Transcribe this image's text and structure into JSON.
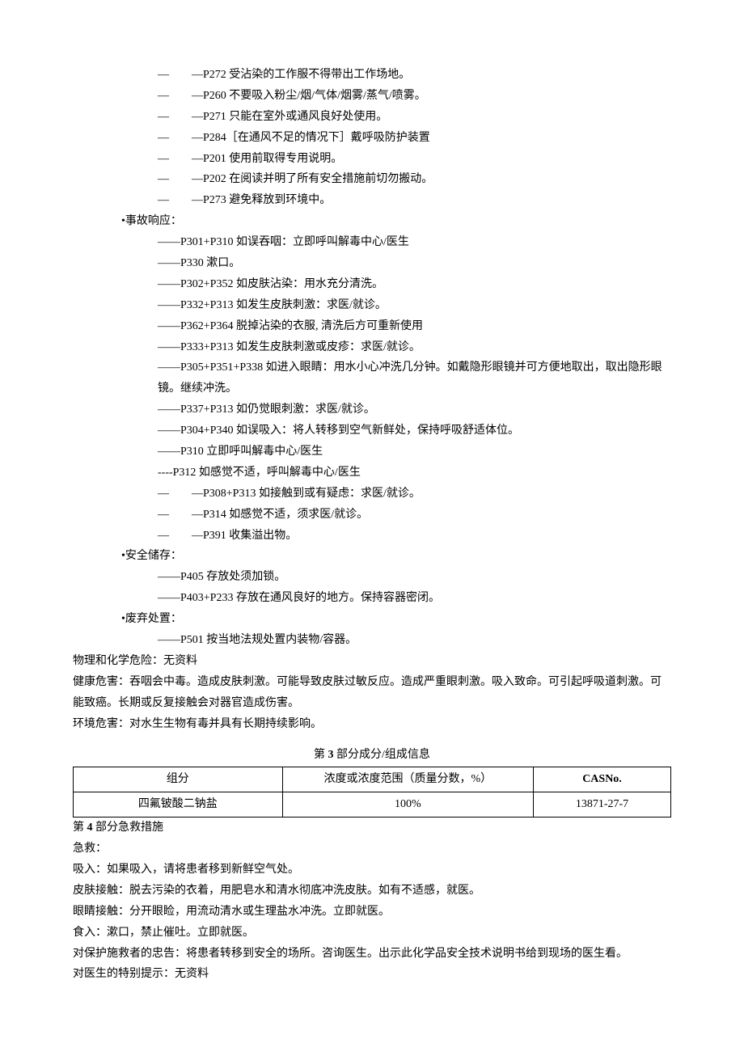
{
  "prevention": [
    "—　　—P272 受沾染的工作服不得带出工作场地。",
    "—　　—P260 不要吸入粉尘/烟/气体/烟雾/蒸气/喷雾。",
    "—　　—P271 只能在室外或通风良好处使用。",
    "—　　—P284［在通风不足的情况下］戴呼吸防护装置",
    "—　　—P201 使用前取得专用说明。",
    "—　　—P202 在阅读并明了所有安全措施前切勿搬动。",
    "—　　—P273 避免释放到环境中。"
  ],
  "response_title": "•事故响应：",
  "response": [
    "——P301+P310 如误吞咽：立即呼叫解毒中心/医生",
    "——P330 漱口。",
    "——P302+P352 如皮肤沾染：用水充分清洗。",
    "——P332+P313 如发生皮肤刺激：求医/就诊。",
    "——P362+P364 脱掉沾染的衣服, 清洗后方可重新使用",
    "——P333+P313 如发生皮肤刺激或皮疹：求医/就诊。",
    "——P305+P351+P338 如进入眼睛：用水小心冲洗几分钟。如戴隐形眼镜并可方便地取出，取出隐形眼镜。继续冲洗。",
    "——P337+P313 如仍觉眼刺激：求医/就诊。",
    "——P304+P340 如误吸入：将人转移到空气新鲜处，保持呼吸舒适体位。",
    "——P310 立即呼叫解毒中心/医生",
    "----P312 如感觉不适，呼叫解毒中心/医生",
    "—　　—P308+P313 如接触到或有疑虑：求医/就诊。",
    "—　　—P314 如感觉不适，须求医/就诊。",
    "—　　—P391 收集溢出物。"
  ],
  "storage_title": "•安全储存：",
  "storage": [
    "——P405 存放处须加锁。",
    "——P403+P233 存放在通风良好的地方。保持容器密闭。"
  ],
  "disposal_title": "•废弃处置：",
  "disposal": [
    "——P501 按当地法规处置内装物/容器。"
  ],
  "phys_chem": "物理和化学危险：无资料",
  "health": "健康危害：吞咽会中毒。造成皮肤刺激。可能导致皮肤过敏反应。造成严重眼刺激。吸入致命。可引起呼吸道刺激。可能致癌。长期或反复接触会对器官造成伤害。",
  "env": "环境危害：对水生生物有毒并具有长期持续影响。",
  "section3": {
    "title_prefix": "第 ",
    "title_num": "3",
    "title_suffix": " 部分成分/组成信息",
    "headers": [
      "组分",
      "浓度或浓度范围（质量分数，%）",
      "CASNo."
    ],
    "row": [
      "四氟铍酸二钠盐",
      "100%",
      "13871-27-7"
    ]
  },
  "section4": {
    "title_prefix": "第 ",
    "title_num": "4",
    "title_suffix": " 部分急救措施",
    "lines": [
      "急救：",
      "吸入：如果吸入，请将患者移到新鲜空气处。",
      "皮肤接触：脱去污染的衣着，用肥皂水和清水彻底冲洗皮肤。如有不适感，就医。",
      "眼睛接触：分开眼睑，用流动清水或生理盐水冲洗。立即就医。",
      "食入：漱口，禁止催吐。立即就医。",
      "对保护施救者的忠告：将患者转移到安全的场所。咨询医生。出示此化学品安全技术说明书给到现场的医生看。",
      "对医生的特别提示：无资料"
    ]
  }
}
